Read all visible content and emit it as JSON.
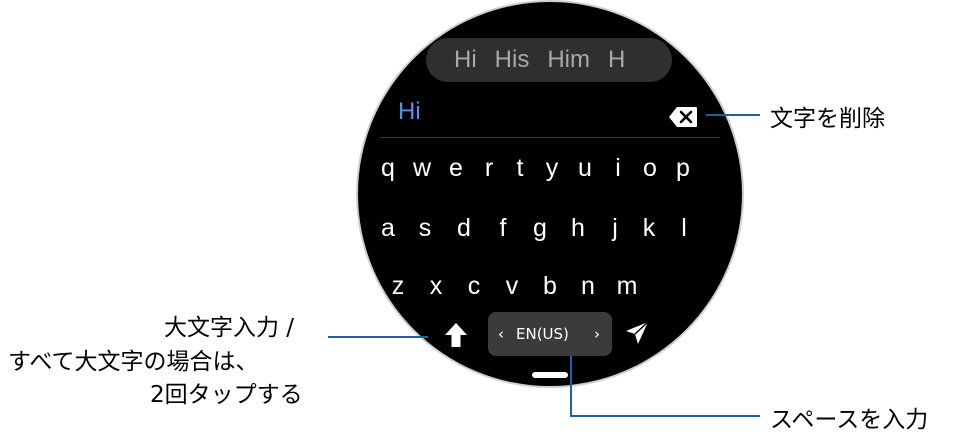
{
  "keyboard": {
    "suggestions": [
      "Hi",
      "His",
      "Him",
      "H"
    ],
    "typed_text": "Hi",
    "rows": [
      [
        "q",
        "w",
        "e",
        "r",
        "t",
        "y",
        "u",
        "i",
        "o",
        "p"
      ],
      [
        "a",
        "s",
        "d",
        "f",
        "g",
        "h",
        "j",
        "k",
        "l"
      ],
      [
        "z",
        "x",
        "c",
        "v",
        "b",
        "n",
        "m"
      ]
    ],
    "language": {
      "prev": "‹",
      "label": "EN(US)",
      "next": "›"
    }
  },
  "callouts": {
    "delete": "文字を削除",
    "shift_line1": "大文字入力 /",
    "shift_line2": "すべて大文字の場合は、",
    "shift_line3": "2回タップする",
    "space": "スペースを入力"
  },
  "colors": {
    "accent": "#5a8ff2",
    "leader": "#1f5fa8",
    "key_bg": "#3b3b3b"
  }
}
